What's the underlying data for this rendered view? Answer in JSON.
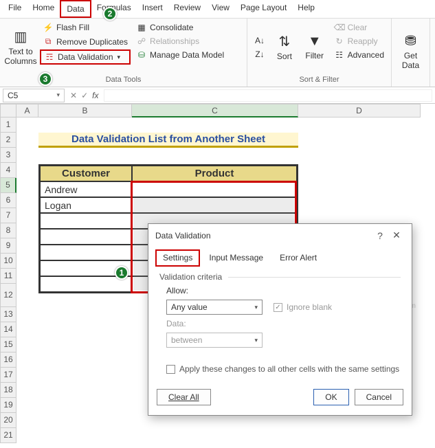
{
  "menu": [
    "File",
    "Home",
    "Data",
    "Formulas",
    "Insert",
    "Review",
    "View",
    "Page Layout",
    "Help"
  ],
  "menu_active": "Data",
  "ribbon": {
    "group1": {
      "text_to_columns": "Text to Columns",
      "flash_fill": "Flash Fill",
      "remove_duplicates": "Remove Duplicates",
      "data_validation": "Data Validation",
      "consolidate": "Consolidate",
      "relationships": "Relationships",
      "manage_data_model": "Manage Data Model",
      "label": "Data Tools"
    },
    "group2": {
      "az": "A→Z",
      "za": "Z→A",
      "sort": "Sort",
      "filter": "Filter",
      "clear": "Clear",
      "reapply": "Reapply",
      "advanced": "Advanced",
      "label": "Sort & Filter"
    },
    "group3": {
      "get_data": "Get Data"
    }
  },
  "badges": {
    "b1": "1",
    "b2": "2",
    "b3": "3"
  },
  "namebox": "C5",
  "columns": [
    "A",
    "B",
    "C",
    "D"
  ],
  "rows": [
    "1",
    "2",
    "3",
    "4",
    "5",
    "6",
    "7",
    "8",
    "9",
    "10",
    "11",
    "12",
    "13",
    "14",
    "15",
    "16",
    "17",
    "18",
    "19",
    "20",
    "21"
  ],
  "title": "Data Validation List from Another Sheet",
  "table": {
    "headers": {
      "customer": "Customer",
      "product": "Product"
    },
    "rows": [
      {
        "customer": "Andrew",
        "product": ""
      },
      {
        "customer": "Logan",
        "product": ""
      },
      {
        "customer": "",
        "product": ""
      },
      {
        "customer": "",
        "product": ""
      },
      {
        "customer": "",
        "product": ""
      },
      {
        "customer": "",
        "product": ""
      },
      {
        "customer": "",
        "product": ""
      }
    ]
  },
  "dialog": {
    "title": "Data Validation",
    "tabs": {
      "settings": "Settings",
      "input_message": "Input Message",
      "error_alert": "Error Alert"
    },
    "criteria_label": "Validation criteria",
    "allow_label": "Allow:",
    "allow_value": "Any value",
    "ignore_blank": "Ignore blank",
    "data_label": "Data:",
    "data_value": "between",
    "apply_label": "Apply these changes to all other cells with the same settings",
    "clear_all": "Clear All",
    "ok": "OK",
    "cancel": "Cancel"
  },
  "watermark": "wsxdn.com"
}
